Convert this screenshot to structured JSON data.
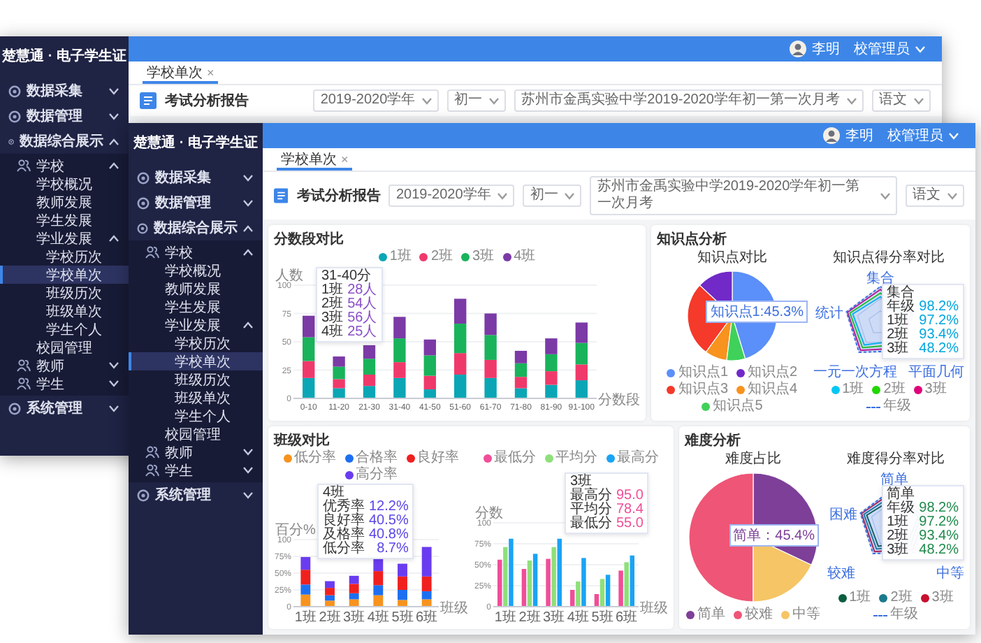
{
  "back_window": {
    "sidebar": {
      "title": "楚慧通 · 电子学生证",
      "items": [
        {
          "label": "数据采集",
          "expanded": false
        },
        {
          "label": "数据管理",
          "expanded": false
        },
        {
          "label": "数据综合展示",
          "expanded": true,
          "children": [
            {
              "label": "学校",
              "expanded": true,
              "children": [
                {
                  "label": "学校概况",
                  "selected": false
                },
                {
                  "label": "教师发展",
                  "selected": false
                },
                {
                  "label": "学生发展",
                  "selected": false
                },
                {
                  "label": "学业发展",
                  "expanded": true,
                  "children": [
                    {
                      "label": "学校历次",
                      "selected": false
                    },
                    {
                      "label": "学校单次",
                      "selected": true
                    },
                    {
                      "label": "班级历次",
                      "selected": false
                    },
                    {
                      "label": "班级单次",
                      "selected": false
                    },
                    {
                      "label": "学生个人",
                      "selected": false
                    }
                  ]
                },
                {
                  "label": "校园管理",
                  "selected": false
                }
              ]
            },
            {
              "label": "教师",
              "expanded": false
            },
            {
              "label": "学生",
              "expanded": false
            }
          ]
        },
        {
          "label": "系统管理",
          "expanded": false
        }
      ]
    },
    "topbar": {
      "user": "李明",
      "role": "校管理员"
    },
    "tabs": [
      {
        "label": "学校单次",
        "close": "×",
        "selected": true
      }
    ],
    "page_title": "考试分析报告",
    "filters": [
      {
        "value": "2019-2020学年"
      },
      {
        "value": "初一"
      },
      {
        "value": "苏州市金禹实验中学2019-2020学年初一第一次月考"
      },
      {
        "value": "语文"
      }
    ]
  },
  "front_window": {
    "sidebar": {
      "title": "楚慧通 · 电子学生证",
      "items": [
        {
          "label": "数据采集",
          "expanded": false
        },
        {
          "label": "数据管理",
          "expanded": false
        },
        {
          "label": "数据综合展示",
          "expanded": true,
          "children": [
            {
              "label": "学校",
              "expanded": true,
              "children": [
                {
                  "label": "学校概况",
                  "selected": false
                },
                {
                  "label": "教师发展",
                  "selected": false
                },
                {
                  "label": "学生发展",
                  "selected": false
                },
                {
                  "label": "学业发展",
                  "expanded": true,
                  "children": [
                    {
                      "label": "学校历次",
                      "selected": false
                    },
                    {
                      "label": "学校单次",
                      "selected": true
                    },
                    {
                      "label": "班级历次",
                      "selected": false
                    },
                    {
                      "label": "班级单次",
                      "selected": false
                    },
                    {
                      "label": "学生个人",
                      "selected": false
                    }
                  ]
                },
                {
                  "label": "校园管理",
                  "selected": false
                }
              ]
            },
            {
              "label": "教师",
              "expanded": false
            },
            {
              "label": "学生",
              "expanded": false
            }
          ]
        },
        {
          "label": "系统管理",
          "expanded": false
        }
      ]
    },
    "topbar": {
      "user": "李明",
      "role": "校管理员"
    },
    "tabs": [
      {
        "label": "学校单次",
        "close": "×",
        "selected": true
      }
    ],
    "page_title": "考试分析报告",
    "filters": [
      {
        "value": "2019-2020学年"
      },
      {
        "value": "初一"
      },
      {
        "value": "苏州市金禹实验中学2019-2020学年初一第一次月考"
      },
      {
        "value": "语文"
      }
    ],
    "cards": [
      {
        "title": "分数段对比",
        "panels": [
          {
            "kind": "bar",
            "chart_data": {
              "type": "bar",
              "stacked": true,
              "grid": true,
              "ylabel": "人数",
              "xlabel": "分数段",
              "categories": [
                "0-10",
                "11-20",
                "21-30",
                "31-40",
                "41-50",
                "51-60",
                "61-70",
                "71-80",
                "81-90",
                "91-100"
              ],
              "ylim": [
                0,
                100
              ],
              "yticks": [
                0,
                25,
                50,
                75,
                100
              ],
              "series": [
                {
                  "name": "1班",
                  "color": "#0aa6b5",
                  "values": [
                    18,
                    9,
                    11,
                    18,
                    8,
                    21,
                    18,
                    9,
                    12,
                    16
                  ]
                },
                {
                  "name": "2班",
                  "color": "#f0396b",
                  "values": [
                    15,
                    8,
                    10,
                    14,
                    12,
                    19,
                    16,
                    10,
                    12,
                    14
                  ]
                },
                {
                  "name": "3班",
                  "color": "#19b35b",
                  "values": [
                    21,
                    11,
                    14,
                    21,
                    18,
                    26,
                    22,
                    12,
                    15,
                    19
                  ]
                },
                {
                  "name": "4班",
                  "color": "#7b3aa6",
                  "values": [
                    19,
                    9,
                    12,
                    19,
                    14,
                    22,
                    19,
                    11,
                    14,
                    18
                  ]
                }
              ]
            },
            "tooltip": {
              "title": "31-40分",
              "rows": [
                {
                  "label": "1班",
                  "value": "28人"
                },
                {
                  "label": "2班",
                  "value": "54人"
                },
                {
                  "label": "3班",
                  "value": "56人"
                },
                {
                  "label": "4班",
                  "value": "25人"
                }
              ]
            }
          }
        ]
      },
      {
        "title": "知识点分析",
        "panels": [
          {
            "kind": "pie",
            "chart_data": {
              "type": "pie",
              "title": "知识点对比",
              "categories": [
                "知识点1",
                "知识点2",
                "知识点3",
                "知识点4",
                "知识点5"
              ],
              "values": [
                45.3,
                13,
                27,
                8,
                6.7
              ],
              "colors": [
                "#5b8ff9",
                "#7129c8",
                "#f5392a",
                "#f7931e",
                "#3fd15a"
              ],
              "annotations": [
                {
                  "text": "知识点1:45.3%"
                }
              ]
            }
          },
          {
            "kind": "radar",
            "title": "知识点得分率对比",
            "axes": [
              "集合",
              "统计",
              "一元一次方程",
              "平面几何"
            ],
            "legend": [
              {
                "label": "1班",
                "color": "#00c8f5",
                "kind": "dot"
              },
              {
                "label": "2班",
                "color": "#22d600",
                "kind": "dot"
              },
              {
                "label": "3班",
                "color": "#e0007a",
                "kind": "dot"
              },
              {
                "label": "年级",
                "color": "#3b6fe0",
                "kind": "line"
              }
            ],
            "tooltip": {
              "title": "集合",
              "rows": [
                {
                  "label": "年级",
                  "value": "98.2%"
                },
                {
                  "label": "1班",
                  "value": "97.2%"
                },
                {
                  "label": "2班",
                  "value": "93.4%"
                },
                {
                  "label": "3班",
                  "value": "48.2%"
                }
              ]
            }
          }
        ]
      },
      {
        "title": "班级对比",
        "panels": [
          {
            "kind": "bar",
            "chart_data": {
              "type": "bar",
              "stacked": true,
              "grid": true,
              "ylabel": "百分%",
              "xlabel": "班级",
              "categories": [
                "1班",
                "2班",
                "3班",
                "4班",
                "5班",
                "6班"
              ],
              "ylim": [
                0,
                100
              ],
              "yticks": [
                0,
                {
                  "value": 25,
                  "label": "25%"
                },
                {
                  "value": 50,
                  "label": "50%"
                },
                {
                  "value": 75,
                  "label": "75%"
                },
                100
              ],
              "series": [
                {
                  "name": "低分率",
                  "color": "#f7931e",
                  "values": [
                    18,
                    9,
                    11,
                    17,
                    10,
                    11
                  ]
                },
                {
                  "name": "合格率",
                  "color": "#1d6ff2",
                  "values": [
                    15,
                    8,
                    9,
                    15,
                    15,
                    12
                  ]
                },
                {
                  "name": "良好率",
                  "color": "#f0201e",
                  "values": [
                    22,
                    11,
                    14,
                    21,
                    20,
                    22
                  ]
                },
                {
                  "name": "高分率",
                  "color": "#6a3cf0",
                  "values": [
                    19,
                    10,
                    12,
                    19,
                    19,
                    44
                  ]
                }
              ]
            },
            "tooltip": {
              "title": "4班",
              "rows": [
                {
                  "label": "优秀率",
                  "value": "12.2%"
                },
                {
                  "label": "良好率",
                  "value": "40.5%"
                },
                {
                  "label": "及格率",
                  "value": "40.8%"
                },
                {
                  "label": "低分率",
                  "value": "8.7%"
                }
              ]
            }
          },
          {
            "kind": "bar",
            "chart_data": {
              "type": "bar",
              "stacked": false,
              "grid": true,
              "ylabel": "分数",
              "xlabel": "班级",
              "categories": [
                "1班",
                "2班",
                "3班",
                "4班",
                "5班",
                "6班"
              ],
              "ylim": [
                0,
                100
              ],
              "yticks": [
                0,
                {
                  "value": 25,
                  "label": "25%"
                },
                {
                  "value": 50,
                  "label": "50%"
                },
                {
                  "value": 75,
                  "label": "75%"
                },
                100
              ],
              "series": [
                {
                  "name": "最低分",
                  "color": "#f04e98",
                  "values": [
                    56,
                    45,
                    57,
                    20,
                    15,
                    43
                  ]
                },
                {
                  "name": "平均分",
                  "color": "#8ee07a",
                  "values": [
                    71,
                    55,
                    71,
                    30,
                    33,
                    53
                  ]
                },
                {
                  "name": "最高分",
                  "color": "#1aa3f5",
                  "values": [
                    81,
                    63,
                    81,
                    58,
                    38,
                    61
                  ]
                }
              ]
            },
            "tooltip": {
              "title": "3班",
              "rows": [
                {
                  "label": "最高分",
                  "value": "95.0"
                },
                {
                  "label": "平均分",
                  "value": "78.4"
                },
                {
                  "label": "最低分",
                  "value": "55.0"
                }
              ]
            }
          }
        ]
      },
      {
        "title": "难度分析",
        "panels": [
          {
            "kind": "pie",
            "chart_data": {
              "type": "pie",
              "title": "难度占比",
              "categories": [
                "简单",
                "较难",
                "中等"
              ],
              "values": [
                32,
                50,
                18
              ],
              "colors": [
                "#7e3f98",
                "#ef5576",
                "#f5c566"
              ],
              "annotations": [
                {
                  "text": "简单：45.4%"
                }
              ]
            }
          },
          {
            "kind": "radar",
            "title": "难度得分率对比",
            "axes": [
              "简单",
              "困难",
              "较难",
              "中等"
            ],
            "legend": [
              {
                "label": "1班",
                "color": "#0b5e3f",
                "kind": "dot"
              },
              {
                "label": "2班",
                "color": "#1b7a8c",
                "kind": "dot"
              },
              {
                "label": "3班",
                "color": "#c8102e",
                "kind": "dot"
              },
              {
                "label": "年级",
                "color": "#3b6fe0",
                "kind": "line"
              }
            ],
            "tooltip": {
              "title": "简单",
              "rows": [
                {
                  "label": "年级",
                  "value": "98.2%"
                },
                {
                  "label": "1班",
                  "value": "97.2%"
                },
                {
                  "label": "2班",
                  "value": "93.4%"
                },
                {
                  "label": "3班",
                  "value": "48.2%"
                }
              ]
            }
          }
        ]
      }
    ]
  }
}
